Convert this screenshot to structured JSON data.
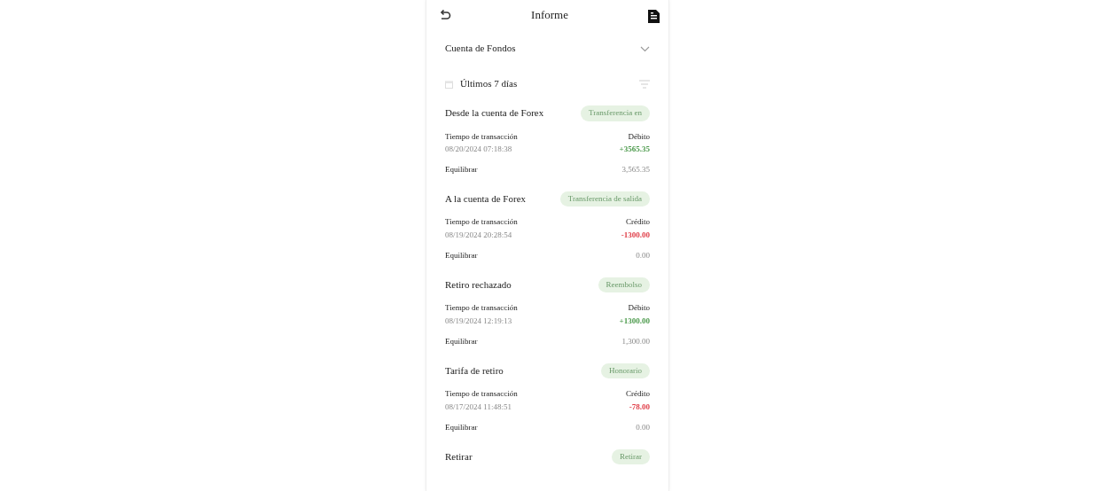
{
  "header": {
    "title": "Informe"
  },
  "account": {
    "label": "Cuenta de Fondos"
  },
  "period": {
    "label": "Últimos 7 días"
  },
  "transactions": [
    {
      "title": "Desde la cuenta de Forex",
      "tag": "Transferencia en",
      "time_label": "Tiempo de transacción",
      "time": "08/20/2024 07:18:38",
      "type_label": "Débito",
      "color": "#4c9a4c",
      "amount": "+3565.35",
      "balance_label": "Equilibrar",
      "balance": "3,565.35"
    },
    {
      "title": "A la cuenta de Forex",
      "tag": "Transferencia de salida",
      "time_label": "Tiempo de transacción",
      "time": "08/19/2024 20:28:54",
      "type_label": "Crédito",
      "color": "#e0404a",
      "amount": "-1300.00",
      "balance_label": "Equilibrar",
      "balance": "0.00"
    },
    {
      "title": "Retiro rechazado",
      "tag": "Reembolso",
      "time_label": "Tiempo de transacción",
      "time": "08/19/2024 12:19:13",
      "type_label": "Débito",
      "color": "#4c9a4c",
      "amount": "+1300.00",
      "balance_label": "Equilibrar",
      "balance": "1,300.00"
    },
    {
      "title": "Tarifa de retiro",
      "tag": "Honorario",
      "time_label": "Tiempo de transacción",
      "time": "08/17/2024 11:48:51",
      "type_label": "Crédito",
      "color": "#e0404a",
      "amount": "-78.00",
      "balance_label": "Equilibrar",
      "balance": "0.00"
    },
    {
      "title": "Retirar",
      "tag": "Retirar"
    }
  ]
}
